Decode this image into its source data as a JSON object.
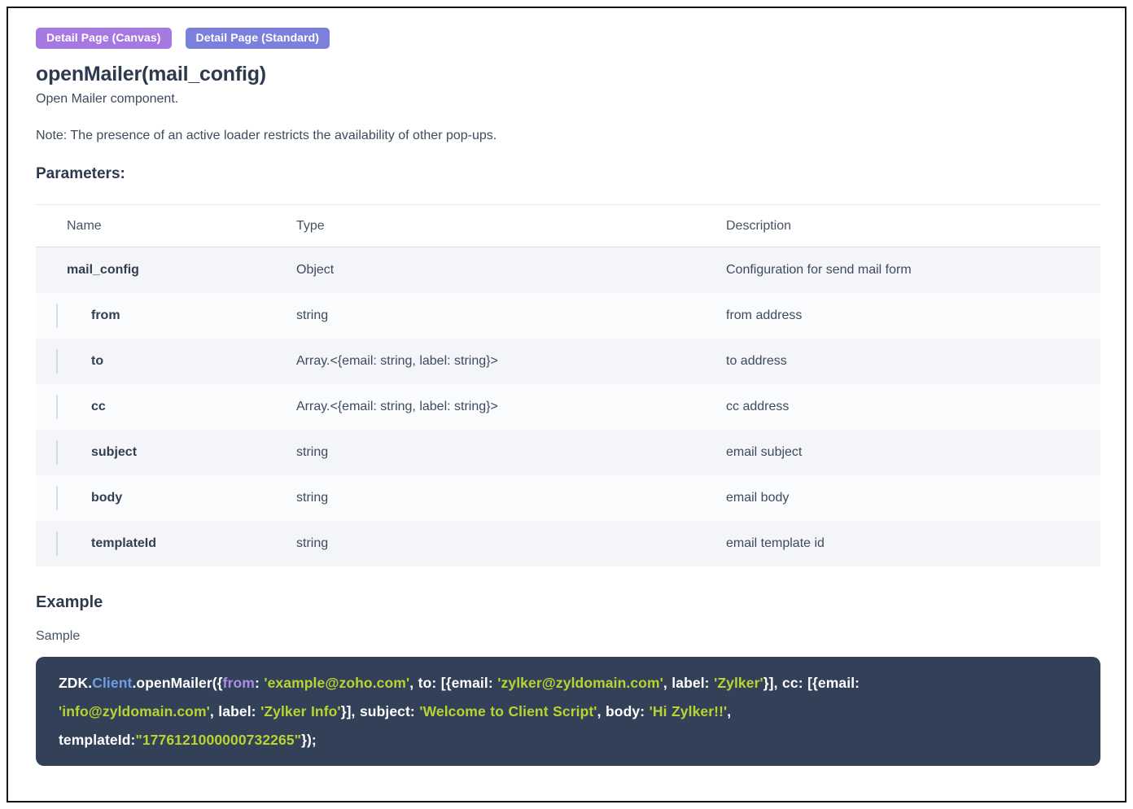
{
  "badges": [
    {
      "label": "Detail Page (Canvas)",
      "color": "#a678e2"
    },
    {
      "label": "Detail Page (Standard)",
      "color": "#7a80dc"
    }
  ],
  "header": {
    "title": "openMailer(mail_config)",
    "subtitle": "Open Mailer component.",
    "note": "Note: The presence of an active loader restricts the availability of other pop-ups."
  },
  "parameters": {
    "heading": "Parameters:",
    "columns": [
      "Name",
      "Type",
      "Description"
    ],
    "rows": [
      {
        "name": "mail_config",
        "type": "Object",
        "description": "Configuration for send mail form",
        "child": false
      },
      {
        "name": "from",
        "type": "string",
        "description": "from address",
        "child": true
      },
      {
        "name": "to",
        "type": "Array.<{email: string, label: string}>",
        "description": "to address",
        "child": true
      },
      {
        "name": "cc",
        "type": "Array.<{email: string, label: string}>",
        "description": "cc address",
        "child": true
      },
      {
        "name": "subject",
        "type": "string",
        "description": "email subject",
        "child": true
      },
      {
        "name": "body",
        "type": "string",
        "description": "email body",
        "child": true
      },
      {
        "name": "templateId",
        "type": "string",
        "description": "email template id",
        "child": true
      }
    ]
  },
  "example": {
    "heading": "Example",
    "label": "Sample",
    "code": {
      "background": "#324158",
      "token_colors": {
        "plain": "#ffffff",
        "class": "#6f9ce5",
        "keyword": "#ab8ce8",
        "string": "#b8d432"
      },
      "tokens": [
        {
          "type": "plain",
          "text": "ZDK."
        },
        {
          "type": "class",
          "text": "Client"
        },
        {
          "type": "plain",
          "text": ".openMailer({"
        },
        {
          "type": "keyword",
          "text": "from"
        },
        {
          "type": "plain",
          "text": ": "
        },
        {
          "type": "string",
          "text": "'example@zoho.com'"
        },
        {
          "type": "plain",
          "text": ", to: [{email: "
        },
        {
          "type": "string",
          "text": "'zylker@zyldomain.com'"
        },
        {
          "type": "plain",
          "text": ", label: "
        },
        {
          "type": "string",
          "text": "'Zylker'"
        },
        {
          "type": "plain",
          "text": "}], cc: [{email:"
        },
        {
          "type": "break",
          "text": ""
        },
        {
          "type": "string",
          "text": "'info@zyldomain.com'"
        },
        {
          "type": "plain",
          "text": ", label: "
        },
        {
          "type": "string",
          "text": "'Zylker Info'"
        },
        {
          "type": "plain",
          "text": "}], subject: "
        },
        {
          "type": "string",
          "text": "'Welcome to Client Script'"
        },
        {
          "type": "plain",
          "text": ", body: "
        },
        {
          "type": "string",
          "text": "'Hi Zylker!!'"
        },
        {
          "type": "plain",
          "text": ","
        },
        {
          "type": "break",
          "text": ""
        },
        {
          "type": "plain",
          "text": "templateId:"
        },
        {
          "type": "string",
          "text": "\"1776121000000732265\""
        },
        {
          "type": "plain",
          "text": "});"
        }
      ]
    }
  }
}
